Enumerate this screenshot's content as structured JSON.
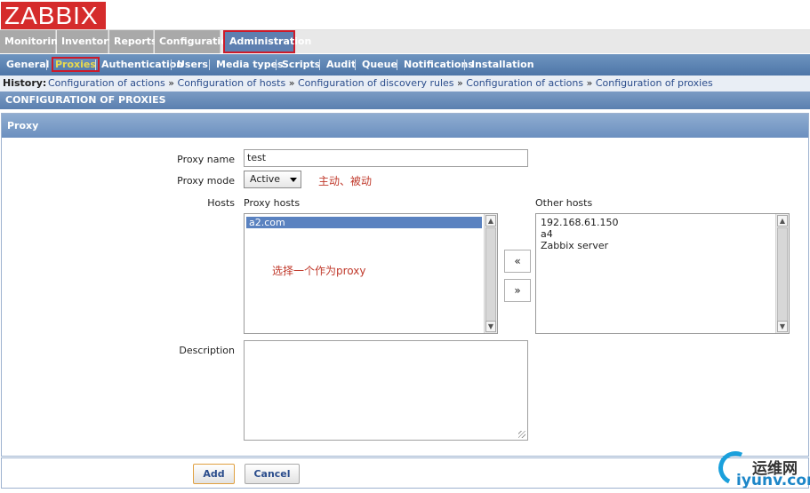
{
  "logo": {
    "text": "ZABBIX"
  },
  "main_menu": [
    "Monitoring",
    "Inventory",
    "Reports",
    "Configuration",
    "Administration"
  ],
  "sub_menu": [
    "General",
    "Proxies",
    "Authentication",
    "Users",
    "Media types",
    "Scripts",
    "Audit",
    "Queue",
    "Notifications",
    "Installation"
  ],
  "history": {
    "label": "History:",
    "crumbs": [
      "Configuration of actions",
      "Configuration of hosts",
      "Configuration of discovery rules",
      "Configuration of actions",
      "Configuration of proxies"
    ],
    "separator": "»"
  },
  "page_title": "CONFIGURATION OF PROXIES",
  "form": {
    "title": "Proxy",
    "proxy_name_label": "Proxy name",
    "proxy_name_value": "test",
    "proxy_mode_label": "Proxy mode",
    "proxy_mode_value": "Active",
    "mode_annotation": "主动、被动",
    "hosts_label": "Hosts",
    "proxy_hosts_label": "Proxy hosts",
    "proxy_hosts": [
      "a2.com"
    ],
    "proxy_annotation": "选择一个作为proxy",
    "other_hosts_label": "Other hosts",
    "other_hosts": [
      "192.168.61.150",
      "a4",
      "Zabbix server"
    ],
    "move_left": "«",
    "move_right": "»",
    "description_label": "Description",
    "description_value": ""
  },
  "buttons": {
    "add": "Add",
    "cancel": "Cancel"
  },
  "watermark": {
    "cn": "运维网",
    "en": "iyunv.com"
  },
  "colors": {
    "brand": "#d52b2b",
    "menu_blue": "#5b80b0",
    "highlight": "#cc1a2a",
    "active_sub": "#e9d94e"
  }
}
